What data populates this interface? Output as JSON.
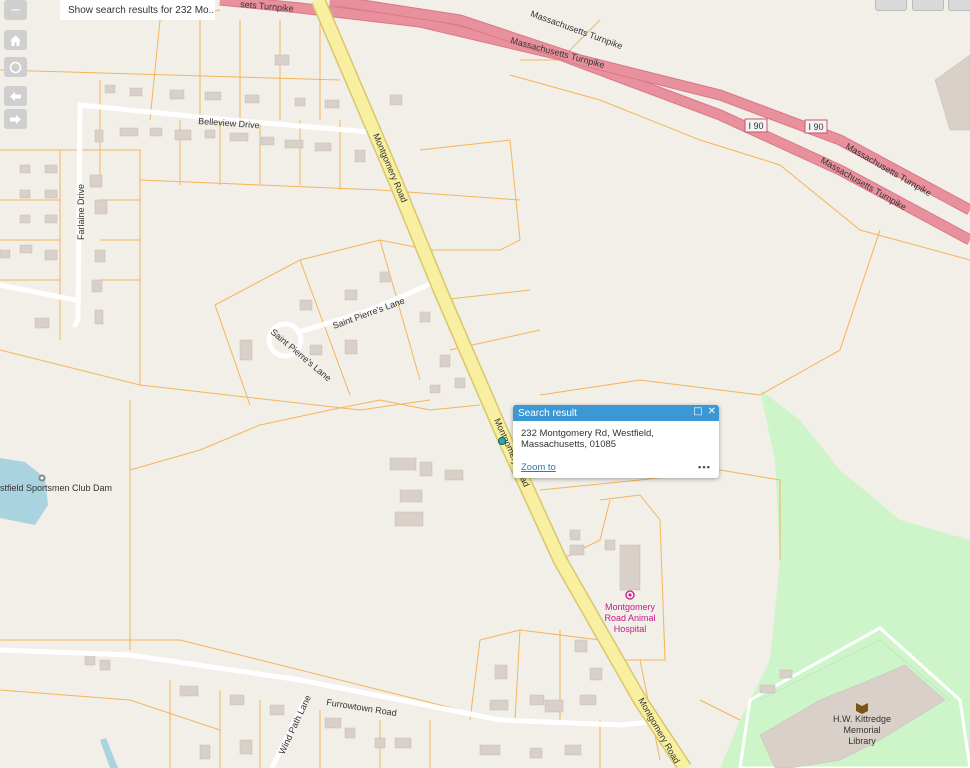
{
  "search_hint": "Show search results for 232 Mo...",
  "toolbar": {
    "zoom_out_icon": "minus-icon",
    "home_icon": "home-icon",
    "locate_icon": "locate-icon",
    "back_icon": "arrow-left-icon",
    "forward_icon": "arrow-right-icon"
  },
  "popup": {
    "title": "Search result",
    "address_line1": "232 Montgomery Rd, Westfield,",
    "address_line2": "Massachusetts, 01085",
    "zoom_link": "Zoom to",
    "more": "•••",
    "maximize_icon": "maximize-icon",
    "close_icon": "close-icon"
  },
  "map_labels": {
    "turnpike1": "Massachusetts Turnpike",
    "turnpike2": "Massachusetts Turnpike",
    "turnpike_top": "sets Turnpike",
    "turnpike_r1": "Massachusetts Turnpike",
    "turnpike_r2": "Massachusetts Turnpike",
    "i90a": "I 90",
    "i90b": "I 90",
    "belleview": "Belleview Drive",
    "montgomery_top": "Montgomery Road",
    "montgomery_mid": "Montgomery Road",
    "montgomery_bottom": "Montgomery Road",
    "farlaine": "Farlaine Drive",
    "saint_pierre": "Saint Pierre's Lane",
    "saint_pierre_circle": "Saint Pierre's Lane",
    "dam": "stfield Sportsmen Club Dam",
    "hospital1": "Montgomery",
    "hospital2": "Road Animal",
    "hospital3": "Hospital",
    "library1": "H.W. Kittredge",
    "library2": "Memorial",
    "library3": "Library",
    "furrowtown": "Furrowtown Road",
    "windpath": "Wind Path Lane"
  },
  "colors": {
    "land": "#f2efe9",
    "parcel": "#f4b45a",
    "turnpike": "#e8919d",
    "main_road": "#f8f0a0",
    "park": "#cdf5c9",
    "water": "#a9d3de",
    "building": "#d9d0c9",
    "popup_header": "#3c97d5",
    "hospital": "#c81888"
  }
}
